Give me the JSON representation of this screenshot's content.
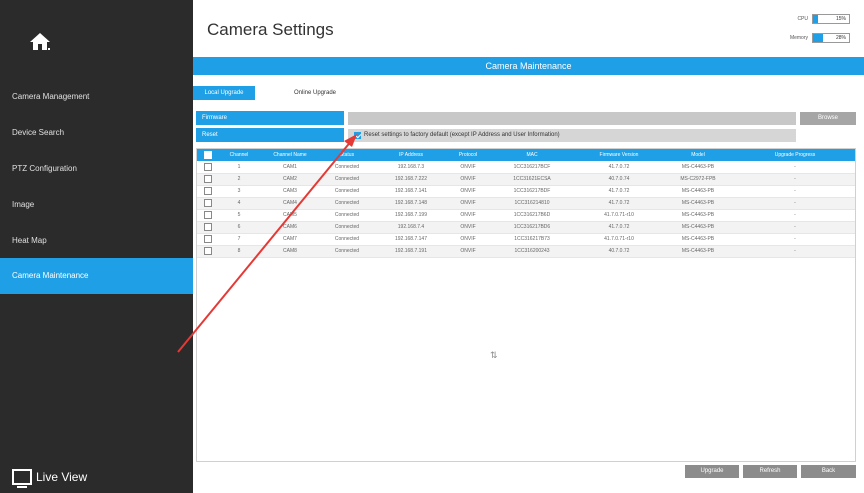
{
  "sidebar": {
    "items": [
      {
        "label": "Camera Management"
      },
      {
        "label": "Device Search"
      },
      {
        "label": "PTZ Configuration"
      },
      {
        "label": "Image"
      },
      {
        "label": "Heat Map"
      },
      {
        "label": "Camera Maintenance"
      }
    ],
    "active_index": 5,
    "live_view_label": "Live View"
  },
  "header": {
    "title": "Camera Settings",
    "cpu_label": "CPU",
    "cpu_value": "15%",
    "cpu_fraction": 0.15,
    "memory_label": "Memory",
    "memory_value": "28%",
    "memory_fraction": 0.28
  },
  "section": {
    "title": "Camera Maintenance"
  },
  "tabs": [
    {
      "label": "Local Upgrade",
      "active": true
    },
    {
      "label": "Online Upgrade",
      "active": false
    }
  ],
  "firmware": {
    "label": "Firmware",
    "browse_label": "Browse"
  },
  "reset": {
    "label": "Reset",
    "checked": true,
    "option_text": "Reset settings to factory default (except IP Address and User Information)"
  },
  "table": {
    "columns": [
      "Channel",
      "Channel Name",
      "Status",
      "IP Address",
      "Protocol",
      "MAC",
      "Firmware Version",
      "Model",
      "Upgrade Progress"
    ],
    "rows": [
      {
        "channel": "1",
        "name": "CAM1",
        "status": "Connected",
        "ip": "192.168.7.3",
        "protocol": "ONVIF",
        "mac": "1CC316217BCF",
        "firmware": "41.7.0.72",
        "model": "MS-C4463-PB",
        "progress": "-"
      },
      {
        "channel": "2",
        "name": "CAM2",
        "status": "Connected",
        "ip": "192.168.7.222",
        "protocol": "ONVIF",
        "mac": "1CC31621ECSA",
        "firmware": "40.7.0.74",
        "model": "MS-C2972-FPB",
        "progress": "-"
      },
      {
        "channel": "3",
        "name": "CAM3",
        "status": "Connected",
        "ip": "192.168.7.141",
        "protocol": "ONVIF",
        "mac": "1CC316217BDF",
        "firmware": "41.7.0.72",
        "model": "MS-C4463-PB",
        "progress": "-"
      },
      {
        "channel": "4",
        "name": "CAM4",
        "status": "Connected",
        "ip": "192.168.7.148",
        "protocol": "ONVIF",
        "mac": "1CC316214810",
        "firmware": "41.7.0.72",
        "model": "MS-C4463-PB",
        "progress": "-"
      },
      {
        "channel": "5",
        "name": "CAM5",
        "status": "Connected",
        "ip": "192.168.7.199",
        "protocol": "ONVIF",
        "mac": "1CC316217B6D",
        "firmware": "41.7.0.71-r10",
        "model": "MS-C4463-PB",
        "progress": "-"
      },
      {
        "channel": "6",
        "name": "CAM6",
        "status": "Connected",
        "ip": "192.168.7.4",
        "protocol": "ONVIF",
        "mac": "1CC316217BD6",
        "firmware": "41.7.0.72",
        "model": "MS-C4463-PB",
        "progress": "-"
      },
      {
        "channel": "7",
        "name": "CAM7",
        "status": "Connected",
        "ip": "192.168.7.147",
        "protocol": "ONVIF",
        "mac": "1CC316217B73",
        "firmware": "41.7.0.71-r10",
        "model": "MS-C4463-PB",
        "progress": "-"
      },
      {
        "channel": "8",
        "name": "CAM8",
        "status": "Connected",
        "ip": "192.168.7.191",
        "protocol": "ONVIF",
        "mac": "1CC316200243",
        "firmware": "40.7.0.72",
        "model": "MS-C4463-PB",
        "progress": "-"
      }
    ]
  },
  "actions": {
    "upgrade_label": "Upgrade",
    "refresh_label": "Refresh",
    "back_label": "Back"
  },
  "colors": {
    "accent": "#1fa0e6",
    "sidebar_bg": "#2b2b2b",
    "annotation_arrow": "#e53935"
  }
}
